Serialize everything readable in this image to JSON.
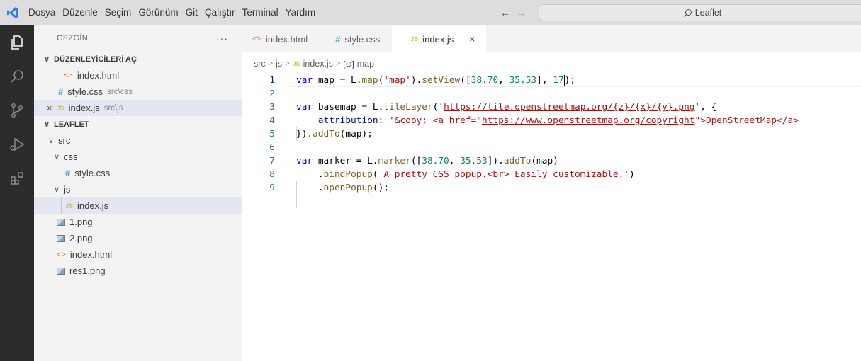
{
  "menu": [
    "Dosya",
    "Düzenle",
    "Seçim",
    "Görünüm",
    "Git",
    "Çalıştır",
    "Terminal",
    "Yardım"
  ],
  "command_center": {
    "text": "Leaflet"
  },
  "sidebar": {
    "title": "GEZGİN",
    "more": "···",
    "open_editors_title": "DÜZENLEYİCİLERİ AÇ",
    "open_editors": [
      {
        "name": "index.html",
        "desc": ""
      },
      {
        "name": "style.css",
        "desc": "src\\css"
      },
      {
        "name": "index.js",
        "desc": "src\\js"
      }
    ],
    "folder_title": "LEAFLET",
    "tree": {
      "src": "src",
      "css": "css",
      "style_css": "style.css",
      "js": "js",
      "index_js": "index.js",
      "files": [
        "1.png",
        "2.png",
        "index.html",
        "res1.png"
      ]
    }
  },
  "tabs": [
    {
      "label": "index.html",
      "icon": "html-icon"
    },
    {
      "label": "style.css",
      "icon": "css-icon"
    },
    {
      "label": "index.js",
      "icon": "js-icon",
      "close": "×"
    }
  ],
  "breadcrumb": {
    "src": "src",
    "js": "js",
    "file": "index.js",
    "symbol": "map"
  },
  "code": {
    "line_numbers": [
      "1",
      "2",
      "3",
      "4",
      "5",
      "6",
      "7",
      "8",
      "9"
    ],
    "l1": {
      "kw": "var",
      "rest1": " map = L.",
      "fn": "map",
      "p1": "(",
      "str": "'map'",
      "p2": ").",
      "fn2": "setView",
      "p3": "([",
      "n1": "38.70",
      "c": ", ",
      "n2": "35.53",
      "p4": "], ",
      "n3a": "17",
      "p5": ");"
    },
    "l3": {
      "kw": "var",
      "rest1": " basemap = L.",
      "fn": "tileLayer",
      "p1": "(",
      "q1": "'",
      "url": "https://tile.openstreetmap.org/{z}/{x}/{y}.png",
      "q2": "'",
      "p2": ", {"
    },
    "l4": {
      "prop": "attribution",
      "p1": ": ",
      "s1": "'&copy; <a href=\"",
      "url": "https://www.openstreetmap.org/copyright",
      "s2": "\">OpenStreetMap</a>"
    },
    "l5": {
      "p1": "}).",
      "fn": "addTo",
      "p2": "(map);"
    },
    "l7": {
      "kw": "var",
      "rest1": " marker = L.",
      "fn": "marker",
      "p1": "([",
      "n1": "38.70",
      "c": ", ",
      "n2": "35.53",
      "p2": "]).",
      "fn2": "addTo",
      "p3": "(map)"
    },
    "l8": {
      "p1": ".",
      "fn": "bindPopup",
      "p2": "(",
      "str": "'A pretty CSS popup.<br> Easily customizable.'",
      "p3": ")"
    },
    "l9": {
      "p1": ".",
      "fn": "openPopup",
      "p2": "();"
    }
  }
}
